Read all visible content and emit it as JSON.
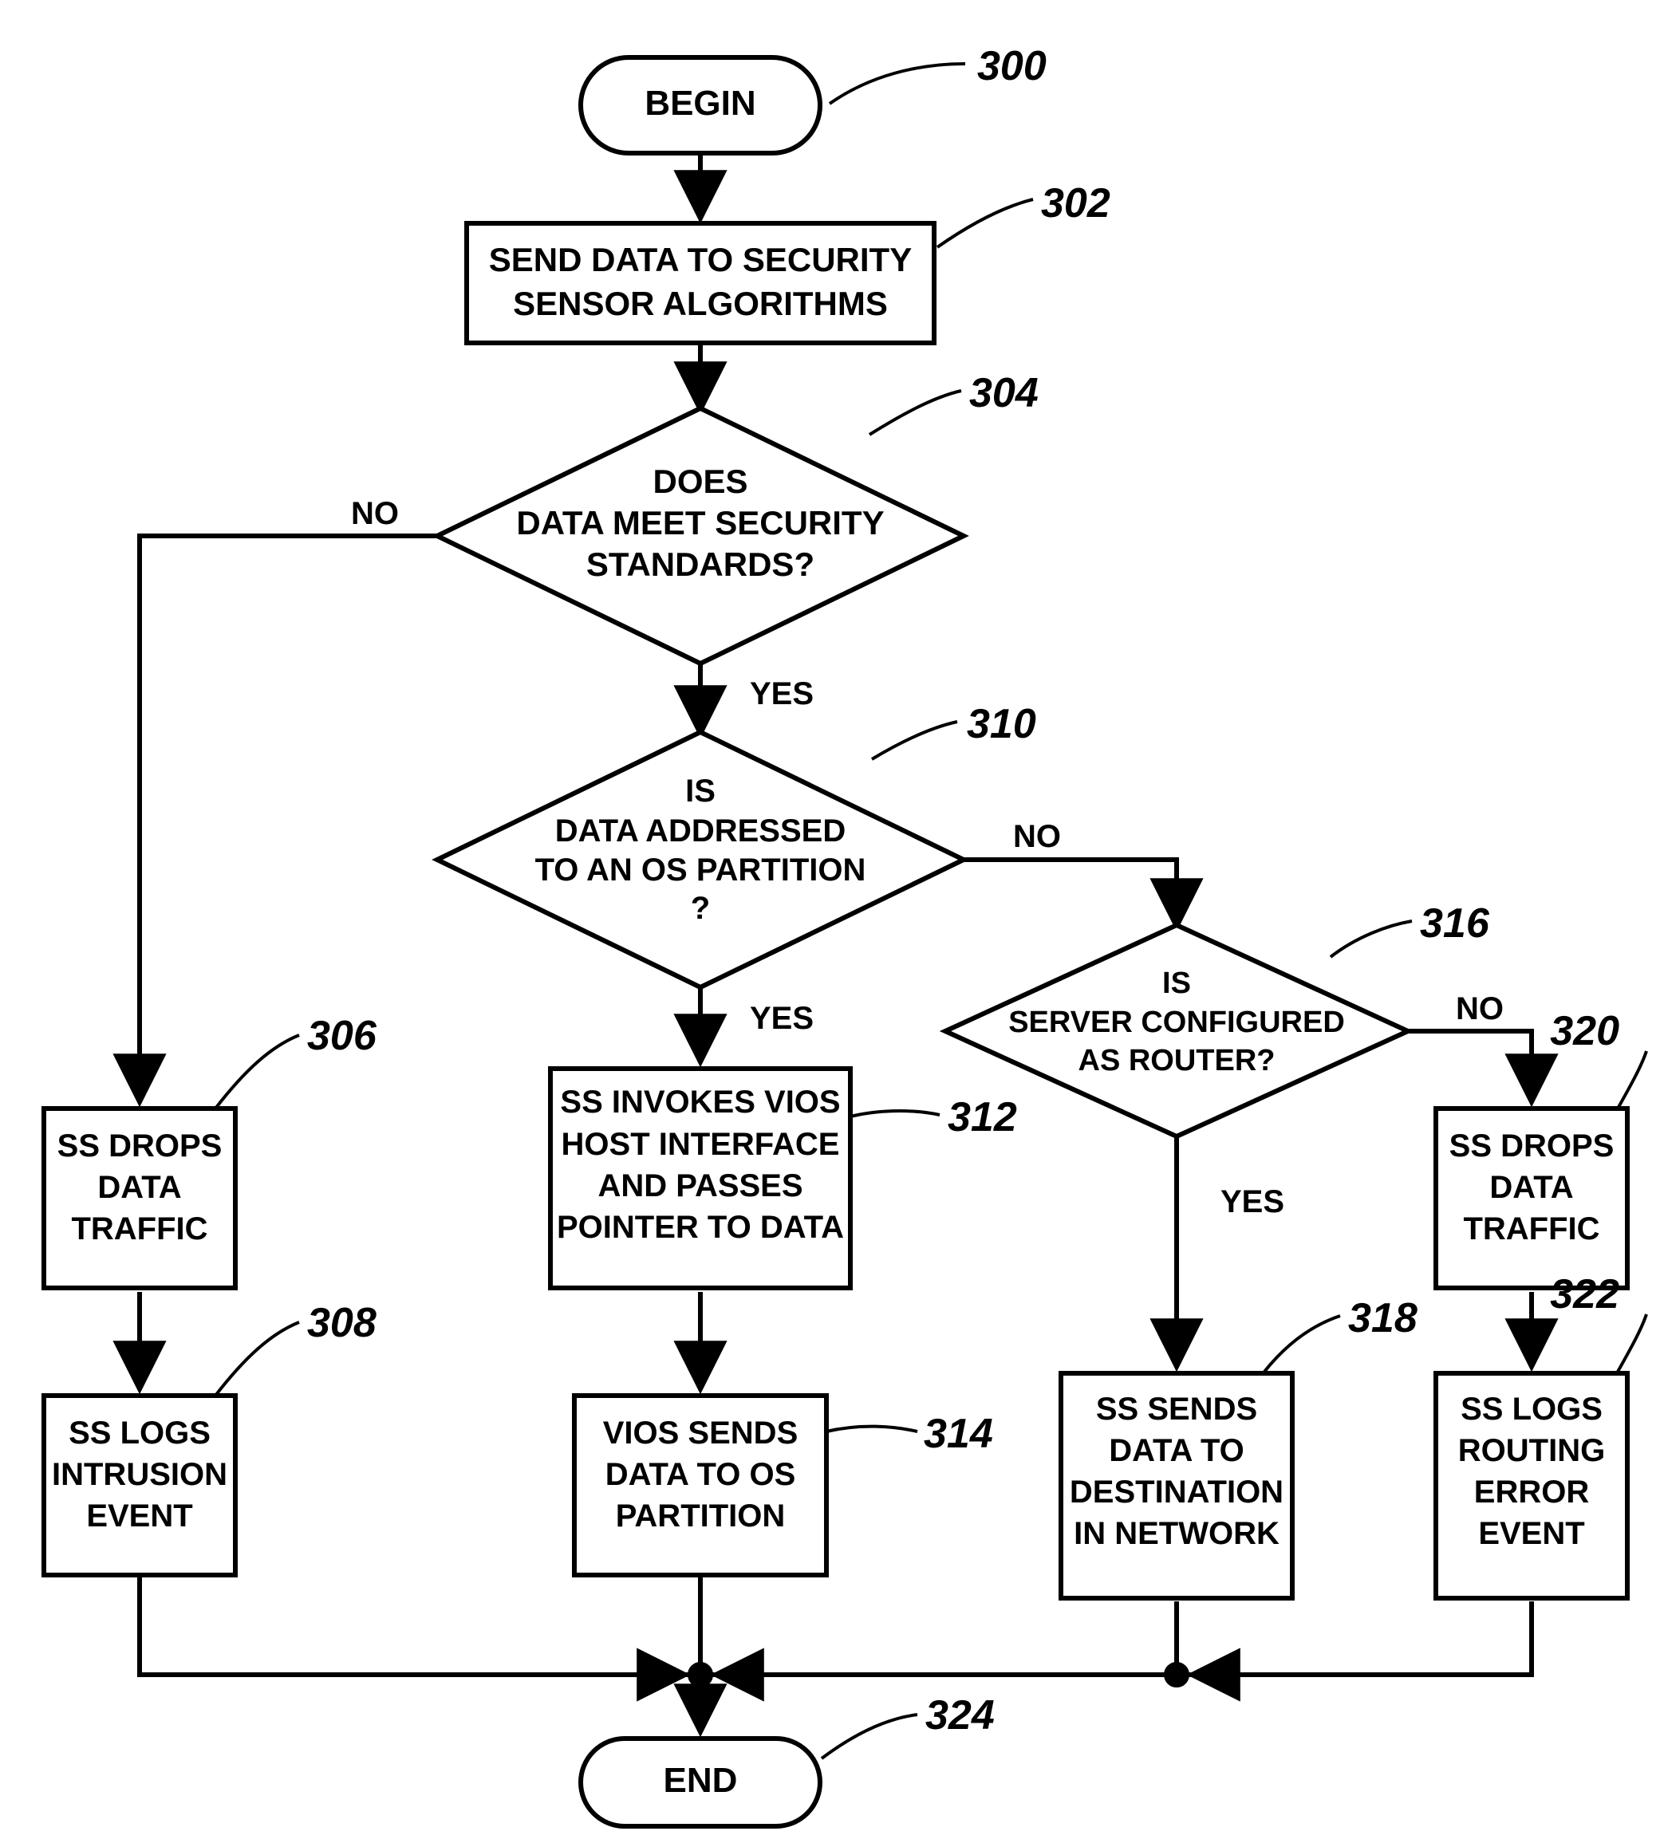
{
  "chart_data": {
    "type": "flowchart",
    "nodes": [
      {
        "id": "300",
        "kind": "terminator",
        "text": [
          "BEGIN"
        ]
      },
      {
        "id": "302",
        "kind": "process",
        "text": [
          "SEND DATA TO SECURITY",
          "SENSOR ALGORITHMS"
        ]
      },
      {
        "id": "304",
        "kind": "decision",
        "text": [
          "DOES",
          "DATA MEET SECURITY",
          "STANDARDS?"
        ]
      },
      {
        "id": "306",
        "kind": "process",
        "text": [
          "SS DROPS",
          "DATA",
          "TRAFFIC"
        ]
      },
      {
        "id": "308",
        "kind": "process",
        "text": [
          "SS LOGS",
          "INTRUSION",
          "EVENT"
        ]
      },
      {
        "id": "310",
        "kind": "decision",
        "text": [
          "IS",
          "DATA ADDRESSED",
          "TO AN OS PARTITION",
          "?"
        ]
      },
      {
        "id": "312",
        "kind": "process",
        "text": [
          "SS INVOKES VIOS",
          "HOST INTERFACE",
          "AND PASSES",
          "POINTER TO DATA"
        ]
      },
      {
        "id": "314",
        "kind": "process",
        "text": [
          "VIOS SENDS",
          "DATA TO OS",
          "PARTITION"
        ]
      },
      {
        "id": "316",
        "kind": "decision",
        "text": [
          "IS",
          "SERVER CONFIGURED",
          "AS ROUTER?"
        ]
      },
      {
        "id": "318",
        "kind": "process",
        "text": [
          "SS SENDS",
          "DATA TO",
          "DESTINATION",
          "IN NETWORK"
        ]
      },
      {
        "id": "320",
        "kind": "process",
        "text": [
          "SS DROPS",
          "DATA",
          "TRAFFIC"
        ]
      },
      {
        "id": "322",
        "kind": "process",
        "text": [
          "SS LOGS",
          "ROUTING",
          "ERROR",
          "EVENT"
        ]
      },
      {
        "id": "324",
        "kind": "terminator",
        "text": [
          "END"
        ]
      }
    ],
    "edges": [
      {
        "from": "300",
        "to": "302"
      },
      {
        "from": "302",
        "to": "304"
      },
      {
        "from": "304",
        "to": "306",
        "label": "NO"
      },
      {
        "from": "304",
        "to": "310",
        "label": "YES"
      },
      {
        "from": "306",
        "to": "308"
      },
      {
        "from": "310",
        "to": "312",
        "label": "YES"
      },
      {
        "from": "310",
        "to": "316",
        "label": "NO"
      },
      {
        "from": "312",
        "to": "314"
      },
      {
        "from": "316",
        "to": "318",
        "label": "YES"
      },
      {
        "from": "316",
        "to": "320",
        "label": "NO"
      },
      {
        "from": "320",
        "to": "322"
      },
      {
        "from": "308",
        "to": "324"
      },
      {
        "from": "314",
        "to": "324"
      },
      {
        "from": "318",
        "to": "324"
      },
      {
        "from": "322",
        "to": "324"
      }
    ]
  },
  "labels": {
    "begin": [
      "BEGIN"
    ],
    "end": [
      "END"
    ],
    "n302": [
      "SEND DATA TO SECURITY",
      "SENSOR ALGORITHMS"
    ],
    "n304": [
      "DOES",
      "DATA MEET SECURITY",
      "STANDARDS?"
    ],
    "n306": [
      "SS DROPS",
      "DATA",
      "TRAFFIC"
    ],
    "n308": [
      "SS LOGS",
      "INTRUSION",
      "EVENT"
    ],
    "n310": [
      "IS",
      "DATA ADDRESSED",
      "TO AN OS PARTITION",
      "?"
    ],
    "n312": [
      "SS INVOKES VIOS",
      "HOST INTERFACE",
      "AND PASSES",
      "POINTER TO DATA"
    ],
    "n314": [
      "VIOS SENDS",
      "DATA TO OS",
      "PARTITION"
    ],
    "n316": [
      "IS",
      "SERVER CONFIGURED",
      "AS ROUTER?"
    ],
    "n318": [
      "SS SENDS",
      "DATA TO",
      "DESTINATION",
      "IN NETWORK"
    ],
    "n320": [
      "SS DROPS",
      "DATA",
      "TRAFFIC"
    ],
    "n322": [
      "SS LOGS",
      "ROUTING",
      "ERROR",
      "EVENT"
    ]
  },
  "tags": {
    "t300": "300",
    "t302": "302",
    "t304": "304",
    "t306": "306",
    "t308": "308",
    "t310": "310",
    "t312": "312",
    "t314": "314",
    "t316": "316",
    "t318": "318",
    "t320": "320",
    "t322": "322",
    "t324": "324"
  },
  "edge_labels": {
    "e304no": "NO",
    "e304yes": "YES",
    "e310no": "NO",
    "e310yes": "YES",
    "e316no": "NO",
    "e316yes": "YES"
  }
}
